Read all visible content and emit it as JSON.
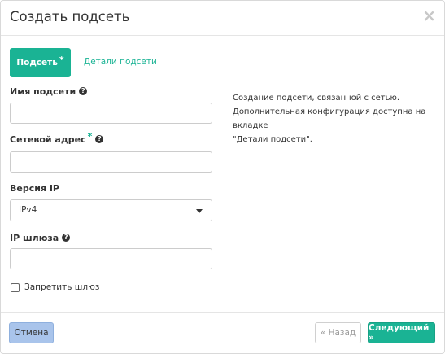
{
  "modal": {
    "title": "Создать подсеть",
    "close_glyph": "×"
  },
  "tabs": [
    {
      "label": "Подсеть",
      "required_mark": "*",
      "active": true
    },
    {
      "label": "Детали подсети",
      "active": false
    }
  ],
  "form": {
    "subnet_name": {
      "label": "Имя подсети",
      "value": ""
    },
    "network_address": {
      "label": "Сетевой адрес",
      "required_mark": "*",
      "value": ""
    },
    "ip_version": {
      "label": "Версия IP",
      "selected": "IPv4"
    },
    "gateway_ip": {
      "label": "IP шлюза",
      "value": ""
    },
    "disable_gateway": {
      "label": "Запретить шлюз",
      "checked": false
    }
  },
  "help_text": {
    "line1": "Создание подсети, связанной с сетью.",
    "line2": "Дополнительная конфигурация доступна на вкладке",
    "line3": "\"Детали подсети\"."
  },
  "footer": {
    "cancel_label": "Отмена",
    "back_label": "« Назад",
    "next_label": "Следующий »"
  },
  "icons": {
    "question": "?"
  },
  "colors": {
    "accent": "#1ab394",
    "cancel_bg": "#a9c4eb"
  }
}
